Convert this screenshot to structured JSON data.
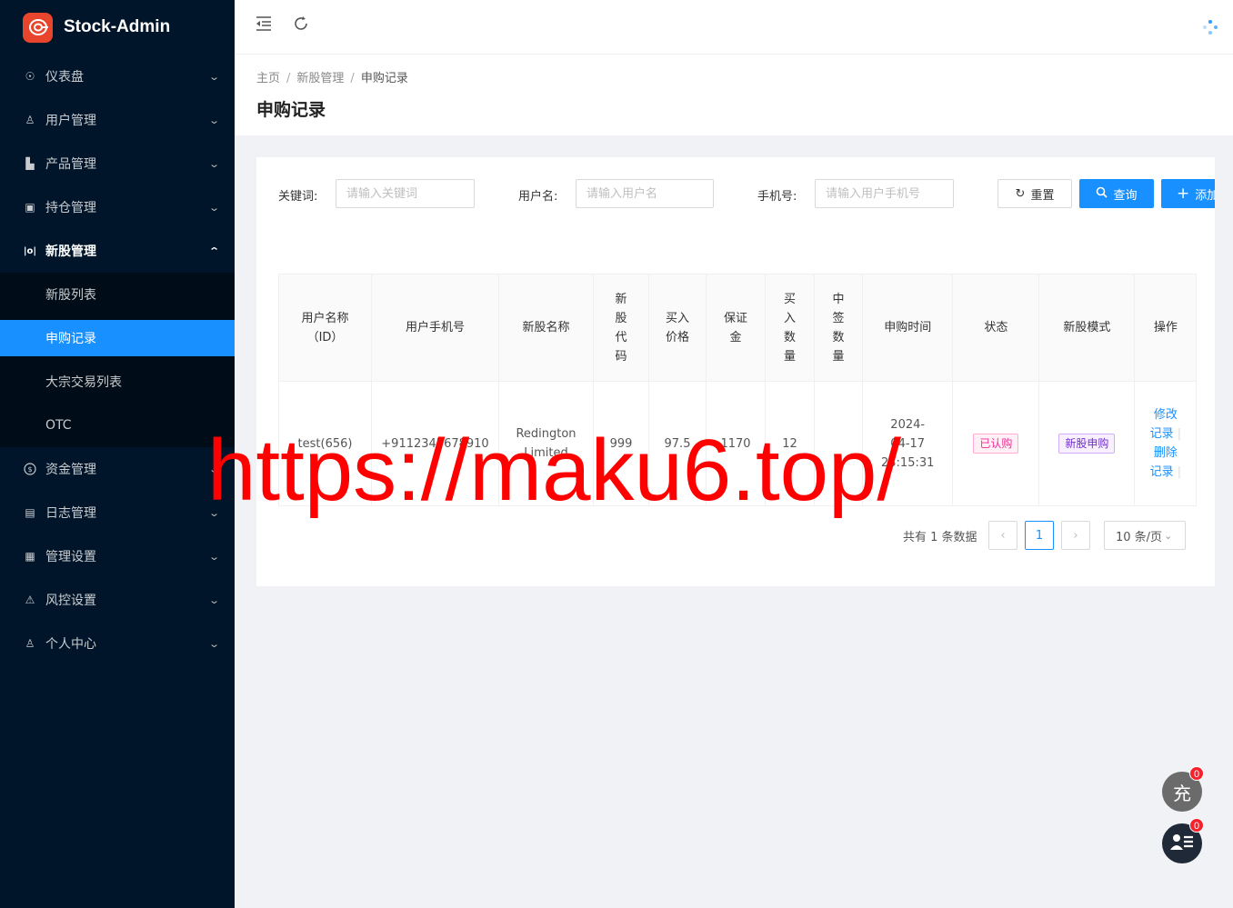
{
  "app": {
    "name": "Stock-Admin"
  },
  "sidebar": {
    "items": [
      {
        "label": "仪表盘",
        "icon": "dashboard-icon",
        "glyph": "☉"
      },
      {
        "label": "用户管理",
        "icon": "users-icon",
        "glyph": "♙"
      },
      {
        "label": "产品管理",
        "icon": "area-chart-icon",
        "glyph": "▙"
      },
      {
        "label": "持仓管理",
        "icon": "file-icon",
        "glyph": "▣"
      },
      {
        "label": "新股管理",
        "icon": "new-stock-icon",
        "glyph": "|o|"
      },
      {
        "label": "资金管理",
        "icon": "dollar-icon",
        "glyph": "$"
      },
      {
        "label": "日志管理",
        "icon": "log-icon",
        "glyph": "▤"
      },
      {
        "label": "管理设置",
        "icon": "settings-icon",
        "glyph": "▦"
      },
      {
        "label": "风控设置",
        "icon": "warning-icon",
        "glyph": "⚠"
      },
      {
        "label": "个人中心",
        "icon": "user-icon",
        "glyph": "♙"
      }
    ],
    "new_stock_sub": [
      "新股列表",
      "申购记录",
      "大宗交易列表",
      "OTC"
    ]
  },
  "breadcrumb": {
    "home": "主页",
    "parent": "新股管理",
    "current": "申购记录"
  },
  "page_title": "申购记录",
  "search": {
    "keyword_label": "关键词:",
    "keyword_placeholder": "请输入关键词",
    "username_label": "用户名:",
    "username_placeholder": "请输入用户名",
    "phone_label": "手机号:",
    "phone_placeholder": "请输入用户手机号",
    "reset": "重置",
    "query": "查询",
    "add": "添加记录"
  },
  "table": {
    "headers": [
      "用户名称（ID）",
      "用户手机号",
      "新股名称",
      "新股代码",
      "买入价格",
      "保证金",
      "买入数量",
      "中签数量",
      "申购时间",
      "状态",
      "新股模式",
      "操作"
    ],
    "rows": [
      {
        "user": "test(656)",
        "phone": "+9112345678910",
        "stock_name": "Redington Limited",
        "code": "999",
        "price": "97.5",
        "deposit": "1170",
        "qty": "12",
        "won": "",
        "time": "2024-04-17 23:15:31",
        "status": "已认购",
        "mode": "新股申购",
        "op_edit": "修改记录",
        "op_delete": "删除记录"
      }
    ]
  },
  "pagination": {
    "total_text": "共有 1 条数据",
    "current_page": "1",
    "page_size": "10 条/页"
  },
  "floating": {
    "recharge_char": "充",
    "recharge_badge": "0",
    "chat_badge": "0"
  },
  "watermark": "https://maku6.top/",
  "colors": {
    "sidebar_bg": "#001529",
    "primary": "#1890ff",
    "logo": "#e8452c",
    "watermark": "#ff0000"
  }
}
